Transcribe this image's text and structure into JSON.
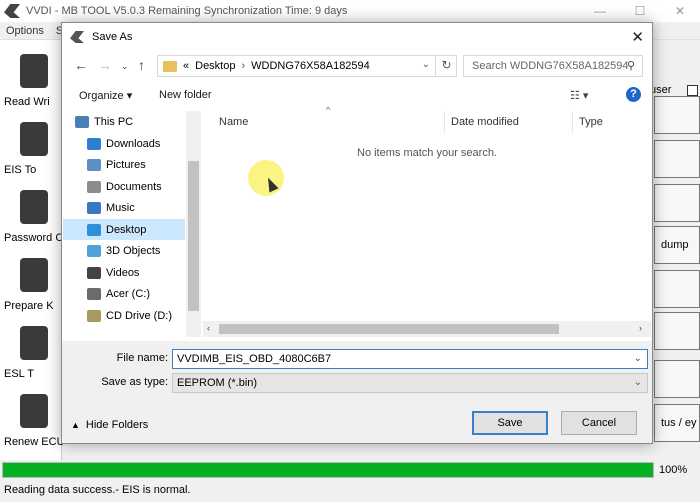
{
  "app": {
    "title": "VVDI - MB TOOL V5.0.3   Remaining Synchronization Time: 9 days",
    "menu": [
      "Options",
      "S"
    ],
    "left_buttons": [
      "Read Wri",
      "EIS To",
      "Password C",
      "Prepare K",
      "ESL T",
      "Renew ECU"
    ],
    "right_boxes": [
      "dump",
      "tus / ey"
    ],
    "user_label": "user",
    "progress_label": "100%",
    "progress_percent": 100,
    "status": "Reading data success.- EIS is normal."
  },
  "dialog": {
    "title": "Save As",
    "address": {
      "prefix": "«",
      "crumbs": [
        "Desktop",
        "WDDNG76X58A182594"
      ]
    },
    "search_placeholder": "Search WDDNG76X58A182594",
    "commands": {
      "organize": "Organize ▾",
      "new_folder": "New folder"
    },
    "nav_items": [
      {
        "label": "This PC",
        "color": "#4a7fb5"
      },
      {
        "label": "Downloads",
        "color": "#2d7fd3"
      },
      {
        "label": "Pictures",
        "color": "#5d8fc2"
      },
      {
        "label": "Documents",
        "color": "#8c8c8c"
      },
      {
        "label": "Music",
        "color": "#3b78c4"
      },
      {
        "label": "Desktop",
        "color": "#2f8fd8"
      },
      {
        "label": "3D Objects",
        "color": "#4da3d8"
      },
      {
        "label": "Videos",
        "color": "#444444"
      },
      {
        "label": "Acer (C:)",
        "color": "#6b6b6b"
      },
      {
        "label": "CD Drive (D:)",
        "color": "#a89a5c"
      }
    ],
    "selected_nav": "Desktop",
    "columns": [
      "Name",
      "Date modified",
      "Type"
    ],
    "empty_message": "No items match your search.",
    "file_name_label": "File name:",
    "file_name_value": "VVDIMB_EIS_OBD_4080C6B7",
    "save_type_label": "Save as type:",
    "save_type_value": "EEPROM (*.bin)",
    "hide_folders": "Hide Folders",
    "save_button": "Save",
    "cancel_button": "Cancel"
  },
  "colors": {
    "progress": "#06b025",
    "selection": "#cce8ff",
    "accent": "#3c7fc4"
  }
}
